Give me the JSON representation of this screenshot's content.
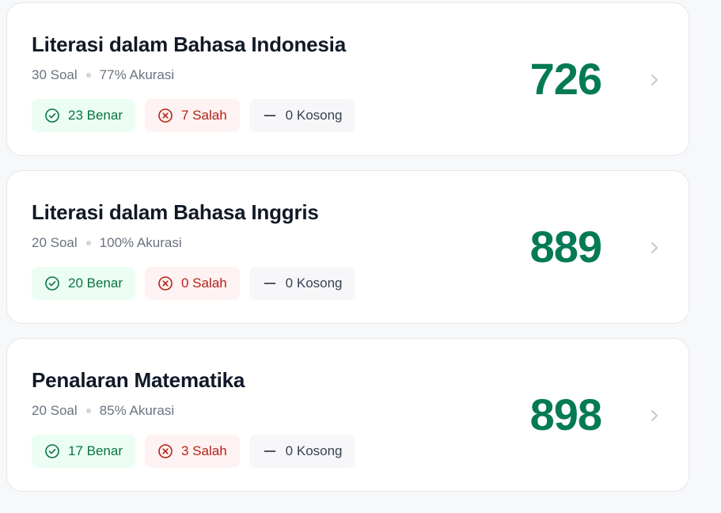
{
  "colors": {
    "score_green": "#047a55",
    "correct_bg": "#ecfdf3",
    "correct_text": "#087443",
    "wrong_bg": "#fef2f2",
    "wrong_text": "#b42318",
    "empty_bg": "#f7f7f9"
  },
  "icons": {
    "correct": "check-circle-icon",
    "wrong": "x-circle-icon",
    "empty": "minus-icon",
    "open": "chevron-right-icon"
  },
  "subjects": [
    {
      "title": "Literasi dalam Bahasa Indonesia",
      "questions": "30 Soal",
      "accuracy": "77% Akurasi",
      "correct": "23 Benar",
      "wrong": "7 Salah",
      "empty": "0 Kosong",
      "score": "726"
    },
    {
      "title": "Literasi dalam Bahasa Inggris",
      "questions": "20 Soal",
      "accuracy": "100% Akurasi",
      "correct": "20 Benar",
      "wrong": "0 Salah",
      "empty": "0 Kosong",
      "score": "889"
    },
    {
      "title": "Penalaran Matematika",
      "questions": "20 Soal",
      "accuracy": "85% Akurasi",
      "correct": "17 Benar",
      "wrong": "3 Salah",
      "empty": "0 Kosong",
      "score": "898"
    }
  ]
}
